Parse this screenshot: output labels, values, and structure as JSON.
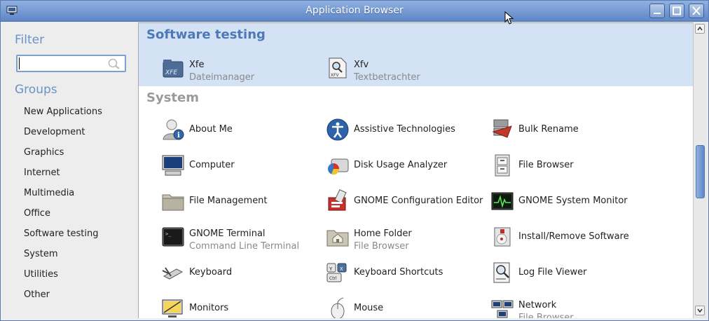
{
  "window": {
    "title": "Application Browser"
  },
  "sidebar": {
    "filter_heading": "Filter",
    "search": {
      "value": "",
      "placeholder": ""
    },
    "groups_heading": "Groups",
    "groups": [
      "New Applications",
      "Development",
      "Graphics",
      "Internet",
      "Multimedia",
      "Office",
      "Software testing",
      "System",
      "Utilities",
      "Other"
    ]
  },
  "sections": [
    {
      "title": "Software testing",
      "apps": [
        {
          "name": "Xfe",
          "sub": "Dateimanager",
          "icon": "xfe-file-manager-icon"
        },
        {
          "name": "Xfv",
          "sub": "Textbetrachter",
          "icon": "xfv-text-viewer-icon"
        }
      ]
    },
    {
      "title": "System",
      "apps": [
        {
          "name": "About Me",
          "icon": "user-info-icon"
        },
        {
          "name": "Assistive Technologies",
          "icon": "accessibility-icon"
        },
        {
          "name": "Bulk Rename",
          "icon": "bulk-rename-icon"
        },
        {
          "name": "Computer",
          "icon": "computer-icon"
        },
        {
          "name": "Disk Usage Analyzer",
          "icon": "disk-usage-icon"
        },
        {
          "name": "File Browser",
          "icon": "file-cabinet-icon"
        },
        {
          "name": "File Management",
          "icon": "folder-icon"
        },
        {
          "name": "GNOME Configuration Editor",
          "icon": "config-editor-icon"
        },
        {
          "name": "GNOME System Monitor",
          "icon": "system-monitor-icon"
        },
        {
          "name": "GNOME Terminal",
          "sub": "Command Line Terminal",
          "icon": "terminal-icon"
        },
        {
          "name": "Home Folder",
          "sub": "File Browser",
          "icon": "home-folder-icon"
        },
        {
          "name": "Install/Remove Software",
          "icon": "package-installer-icon"
        },
        {
          "name": "Keyboard",
          "icon": "keyboard-icon"
        },
        {
          "name": "Keyboard Shortcuts",
          "icon": "keyboard-shortcuts-icon"
        },
        {
          "name": "Log File Viewer",
          "icon": "log-viewer-icon"
        },
        {
          "name": "Monitors",
          "icon": "monitor-icon"
        },
        {
          "name": "Mouse",
          "icon": "mouse-icon"
        },
        {
          "name": "Network",
          "sub": "File Browser",
          "icon": "network-icon"
        }
      ]
    }
  ]
}
